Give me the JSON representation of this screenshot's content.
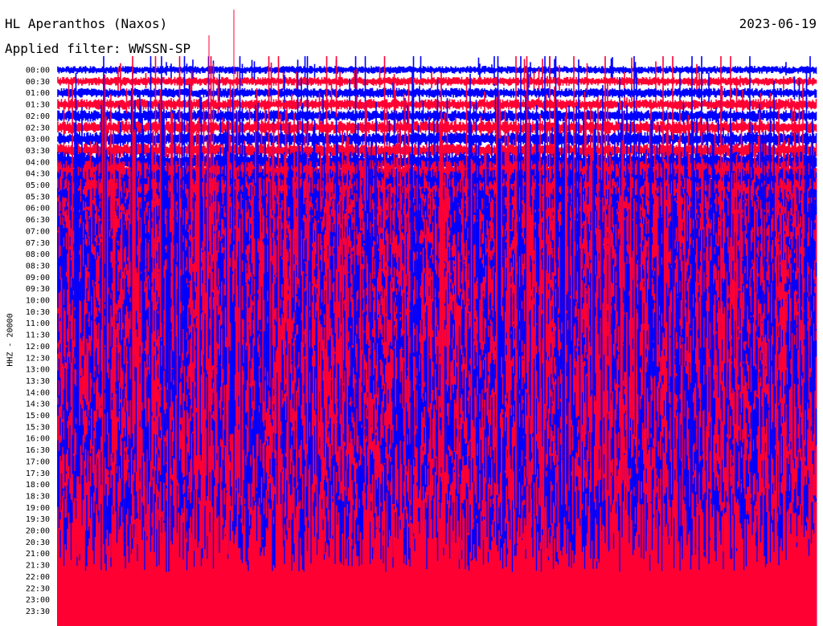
{
  "header": {
    "station": "HL Aperanthos (Naxos)",
    "date": "2023-06-19",
    "filter": "Applied filter: WWSSN-SP"
  },
  "colors": {
    "trace_a": "#0000ff",
    "trace_b": "#ff0033",
    "background": "#ffffff"
  },
  "chart_data": {
    "type": "line",
    "title": "HL Aperanthos (Naxos)",
    "ylabel": "HHZ - 20000",
    "xlabel": "",
    "y_categories": [
      "00:00",
      "00:30",
      "01:00",
      "01:30",
      "02:00",
      "02:30",
      "03:00",
      "03:30",
      "04:00",
      "04:30",
      "05:00",
      "05:30",
      "06:00",
      "06:30",
      "07:00",
      "07:30",
      "08:00",
      "08:30",
      "09:00",
      "09:30",
      "10:00",
      "10:30",
      "11:00",
      "11:30",
      "12:00",
      "12:30",
      "13:00",
      "13:30",
      "14:00",
      "14:30",
      "15:00",
      "15:30",
      "16:00",
      "16:30",
      "17:00",
      "17:30",
      "18:00",
      "18:30",
      "19:00",
      "19:30",
      "20:00",
      "20:30",
      "21:00",
      "21:30",
      "22:00",
      "22:30",
      "23:00",
      "23:30"
    ],
    "series": [
      {
        "color": "#0000ff",
        "rows": "even"
      },
      {
        "color": "#ff0033",
        "rows": "odd"
      }
    ],
    "minutes_per_row": 30,
    "grid": false,
    "legend": "none"
  }
}
